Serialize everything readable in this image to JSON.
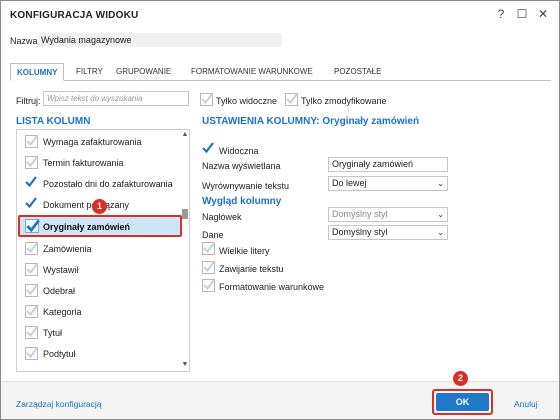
{
  "window": {
    "title": "KONFIGURACJA WIDOKU",
    "help_glyph": "?",
    "maximize_glyph": "☐",
    "close_glyph": "✕"
  },
  "name_field": {
    "label": "Nazwa:",
    "value": "Wydania magazynowe"
  },
  "tabs": [
    {
      "label": "KOLUMNY",
      "active": true
    },
    {
      "label": "FILTRY",
      "active": false
    },
    {
      "label": "GRUPOWANIE",
      "active": false
    },
    {
      "label": "FORMATOWANIE WARUNKOWE",
      "active": false
    },
    {
      "label": "POZOSTAŁE",
      "active": false
    }
  ],
  "filter": {
    "label": "Filtruj:",
    "placeholder": "Wpisz tekst do wyszukania",
    "only_visible_label": "Tylko widoczne",
    "only_modified_label": "Tylko zmodyfikowane"
  },
  "column_list": {
    "title": "LISTA KOLUMN",
    "items": [
      {
        "label": "Wymaga zafakturowania",
        "checked": false
      },
      {
        "label": "Termin fakturowania",
        "checked": false
      },
      {
        "label": "Pozostało dni do zafakturowania",
        "checked": true
      },
      {
        "label": "Dokument powiązany",
        "checked": true
      },
      {
        "label": "Oryginały zamówień",
        "checked": true,
        "selected": true
      },
      {
        "label": "Zamówienia",
        "checked": false
      },
      {
        "label": "Wystawił",
        "checked": false
      },
      {
        "label": "Odebrał",
        "checked": false
      },
      {
        "label": "Kategoria",
        "checked": false
      },
      {
        "label": "Tytuł",
        "checked": false
      },
      {
        "label": "Podtytuł",
        "checked": false
      }
    ]
  },
  "settings": {
    "title": "USTAWIENIA KOLUMNY: Oryginały zamówień",
    "visible_label": "Widoczna",
    "display_name_label": "Nazwa wyświetlana",
    "display_name_value": "Oryginały zamówień",
    "alignment_label": "Wyrównywanie tekstu",
    "alignment_value": "Do lewej",
    "appearance_title": "Wygląd kolumny",
    "header_label": "Nagłówek",
    "header_value": "Domyślny styl",
    "data_label": "Dane",
    "data_value": "Domyślny styl",
    "uppercase_label": "Wielkie litery",
    "wrap_label": "Zawijanie tekstu",
    "conditional_label": "Formatowanie warunkowe"
  },
  "callouts": {
    "first": "1",
    "second": "2"
  },
  "footer": {
    "manage_label": "Zarządzaj konfiguracją",
    "ok_label": "OK",
    "cancel_label": "Anuluj"
  },
  "colors": {
    "accent": "#1a73c7",
    "ok_button": "#1f78c8",
    "highlight": "#d93025",
    "selected_row": "#cde5f7",
    "check_active": "#1a73c7",
    "check_inactive": "#b9d3ea"
  }
}
